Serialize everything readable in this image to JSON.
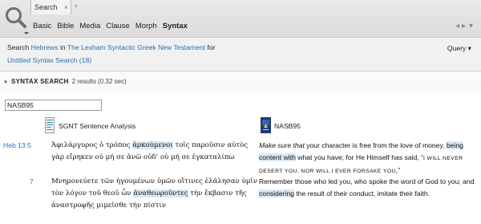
{
  "tab": {
    "label": "Search",
    "close": "×",
    "plus": "+"
  },
  "modes": [
    {
      "label": "Basic"
    },
    {
      "label": "Bible"
    },
    {
      "label": "Media"
    },
    {
      "label": "Clause"
    },
    {
      "label": "Morph"
    },
    {
      "label": "Syntax"
    }
  ],
  "nav": {
    "back": "◂ ▸",
    "menu": "▾"
  },
  "search_def": {
    "prefix": "Search",
    "range": "Hebrews",
    "in_word": "in",
    "resource": "The Lexham Syntactic Greek New Testament",
    "for_word": "for",
    "query_name": "Untitled Syntax Search (18)",
    "query_menu": "Query ▾"
  },
  "results": {
    "label": "SYNTAX SEARCH",
    "count": "2 results (0.32 sec)",
    "filter_value": "NASB95"
  },
  "columns": {
    "left": "SGNT Sentence Analysis",
    "right": "NASB95"
  },
  "rows": [
    {
      "ref": "Heb 13:5",
      "greek_parts": [
        {
          "t": "Ἀφιλάργυρος ὁ τρόπος "
        },
        {
          "t": "ἀρκούμενοι",
          "hl": true
        },
        {
          "t": " τοῖς παροῦσιν αὐτὸς γὰρ εἴρηκεν οὐ μή σε ἀνῶ οὐδ’ οὐ μή σε ἐγκαταλίπω"
        }
      ],
      "eng_parts": [
        {
          "t": "Make sure that",
          "i": true
        },
        {
          "t": " your character is free from the love of money, "
        },
        {
          "t": "being content with",
          "hl": true
        },
        {
          "t": " what you have; for He Himself has said, “"
        },
        {
          "t": "I WILL NEVER DESERT YOU, NOR WILL I EVER FORSAKE YOU",
          "sc": true
        },
        {
          "t": ",”"
        }
      ]
    },
    {
      "ref": "7",
      "greek_parts": [
        {
          "t": "Μνημονεύετε τῶν ἡγουμένων ὑμῶν οἵτινες ἐλάλησαν ὑμῖν τὸν λόγον τοῦ θεοῦ ὧν "
        },
        {
          "t": "ἀναθεωροῦντες",
          "hl": true
        },
        {
          "t": " τὴν ἔκβασιν τῆς ἀναστροφῆς μιμεῖσθε τὴν πίστιν"
        }
      ],
      "eng_parts": [
        {
          "t": "Remember those who led you, who spoke the word of God to you; and "
        },
        {
          "t": "considering",
          "hl": true
        },
        {
          "t": " the result of their conduct, imitate their faith."
        }
      ]
    }
  ]
}
